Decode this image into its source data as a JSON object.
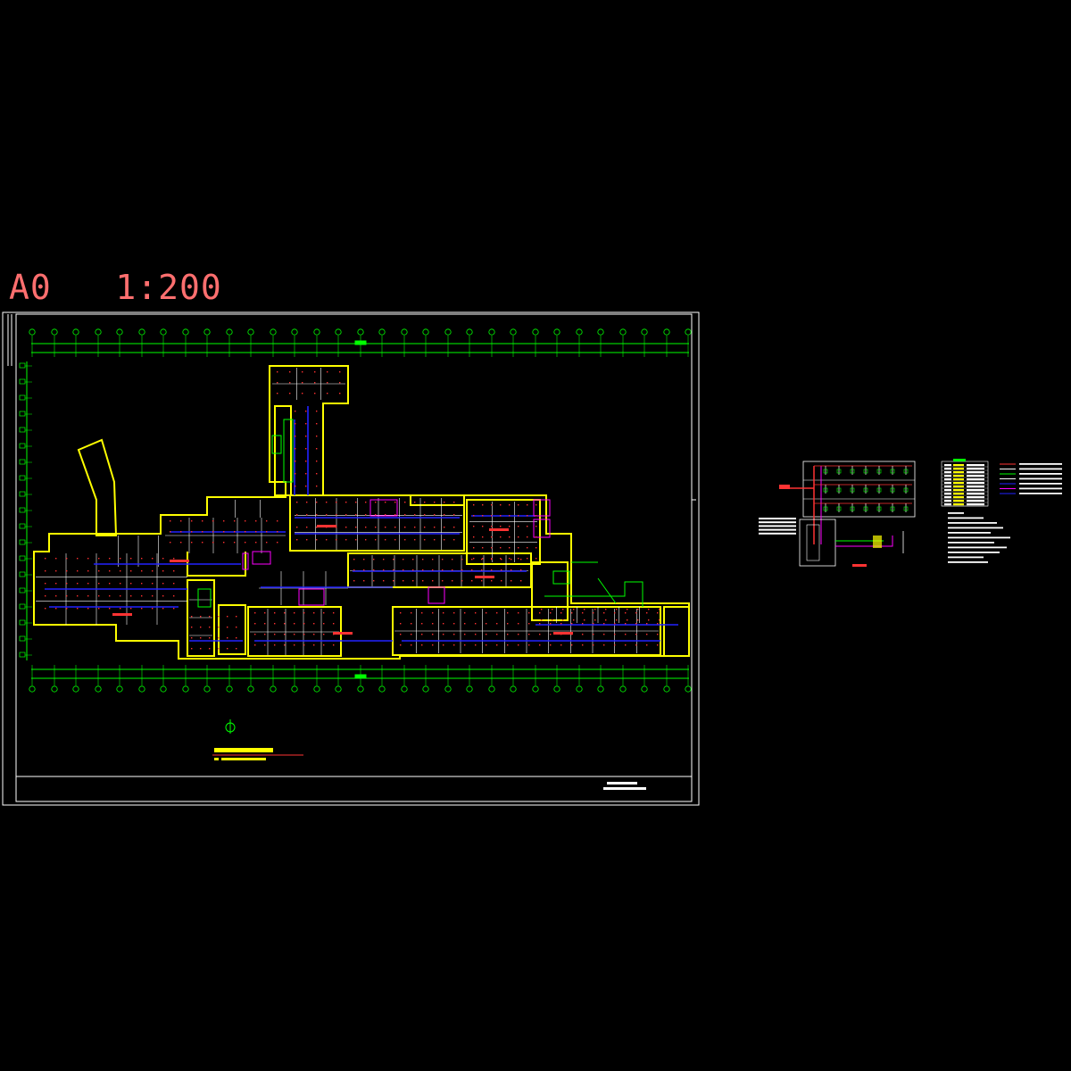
{
  "sheet": {
    "scale_label": "A0   1:200",
    "plan_title": "",
    "title_block_text": ""
  },
  "colors": {
    "background": "#000000",
    "frame": "#ffffff",
    "wall": "#ffff00",
    "axis": "#00ff00",
    "pipe": "#0000ff",
    "partition": "#ffffff",
    "equipment": "#ff00ff",
    "sprinkler": "#ff3030",
    "label": "#ff4040"
  }
}
